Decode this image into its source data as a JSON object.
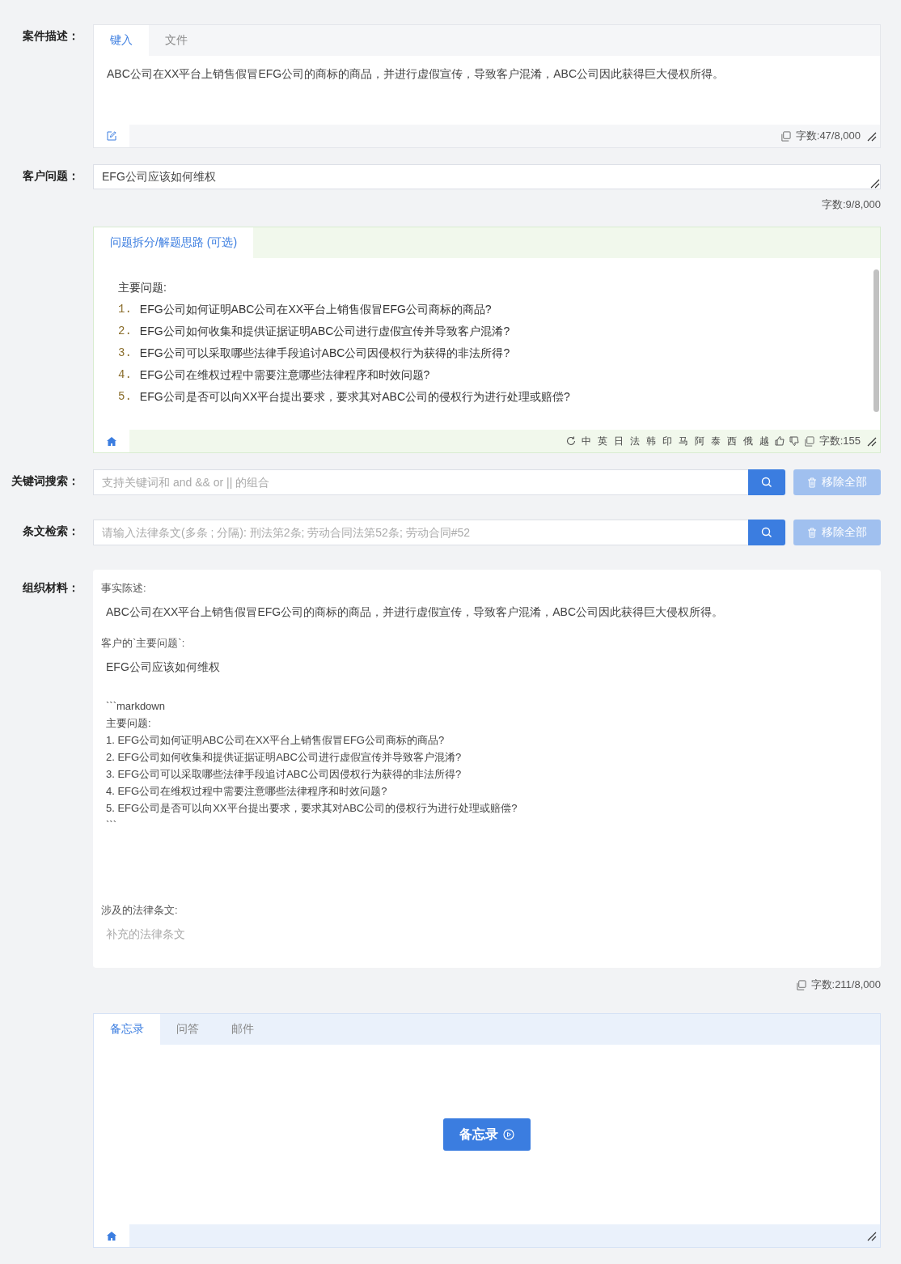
{
  "case_description": {
    "label": "案件描述：",
    "tabs": [
      {
        "label": "键入",
        "selected": true
      },
      {
        "label": "文件",
        "selected": false
      }
    ],
    "text": "ABC公司在XX平台上销售假冒EFG公司的商标的商品，并进行虚假宣传，导致客户混淆，ABC公司因此获得巨大侵权所得。",
    "count": "字数:47/8,000"
  },
  "client_question": {
    "label": "客户问题：",
    "value": "EFG公司应该如何维权",
    "count": "字数:9/8,000"
  },
  "breakdown": {
    "tabs": [
      {
        "label": "问题拆分/解题思路 (可选)",
        "selected": true
      }
    ],
    "heading": "主要问题:",
    "items": [
      {
        "number": "1.",
        "text": "EFG公司如何证明ABC公司在XX平台上销售假冒EFG公司商标的商品?"
      },
      {
        "number": "2.",
        "text": "EFG公司如何收集和提供证据证明ABC公司进行虚假宣传并导致客户混淆?"
      },
      {
        "number": "3.",
        "text": "EFG公司可以采取哪些法律手段追讨ABC公司因侵权行为获得的非法所得?"
      },
      {
        "number": "4.",
        "text": "EFG公司在维权过程中需要注意哪些法律程序和时效问题?"
      },
      {
        "number": "5.",
        "text": "EFG公司是否可以向XX平台提出要求，要求其对ABC公司的侵权行为进行处理或赔偿?"
      }
    ],
    "languages": [
      "中",
      "英",
      "日",
      "法",
      "韩",
      "印",
      "马",
      "阿",
      "泰",
      "西",
      "俄",
      "越"
    ],
    "count": "字数:155"
  },
  "keyword_search": {
    "label": "关键词搜索：",
    "placeholder": "支持关键词和 and && or || 的组合",
    "clear_button": "移除全部"
  },
  "article_search": {
    "label": "条文检索：",
    "placeholder": "请输入法律条文(多条 ; 分隔): 刑法第2条; 劳动合同法第52条; 劳动合同#52",
    "clear_button": "移除全部"
  },
  "materials": {
    "label": "组织材料：",
    "blocks": [
      {
        "kind": "heading",
        "text": "事实陈述:"
      },
      {
        "kind": "body",
        "text": "ABC公司在XX平台上销售假冒EFG公司的商标的商品，并进行虚假宣传，导致客户混淆，ABC公司因此获得巨大侵权所得。"
      },
      {
        "kind": "heading",
        "text": "客户的`主要问题`:"
      },
      {
        "kind": "body",
        "text": "EFG公司应该如何维权"
      },
      {
        "kind": "code",
        "lines": [
          "```markdown",
          "主要问题:",
          "1. EFG公司如何证明ABC公司在XX平台上销售假冒EFG公司商标的商品?",
          "2. EFG公司如何收集和提供证据证明ABC公司进行虚假宣传并导致客户混淆?",
          "3. EFG公司可以采取哪些法律手段追讨ABC公司因侵权行为获得的非法所得?",
          "4. EFG公司在维权过程中需要注意哪些法律程序和时效问题?",
          "5. EFG公司是否可以向XX平台提出要求，要求其对ABC公司的侵权行为进行处理或赔偿?",
          "```"
        ]
      },
      {
        "kind": "heading",
        "text": "涉及的法律条文:"
      },
      {
        "kind": "placeholder",
        "text": "补充的法律条文"
      }
    ],
    "count": "字数:211/8,000"
  },
  "output": {
    "tabs": [
      {
        "label": "备忘录",
        "selected": true
      },
      {
        "label": "问答",
        "selected": false
      },
      {
        "label": "邮件",
        "selected": false
      }
    ],
    "button": "备忘录"
  }
}
